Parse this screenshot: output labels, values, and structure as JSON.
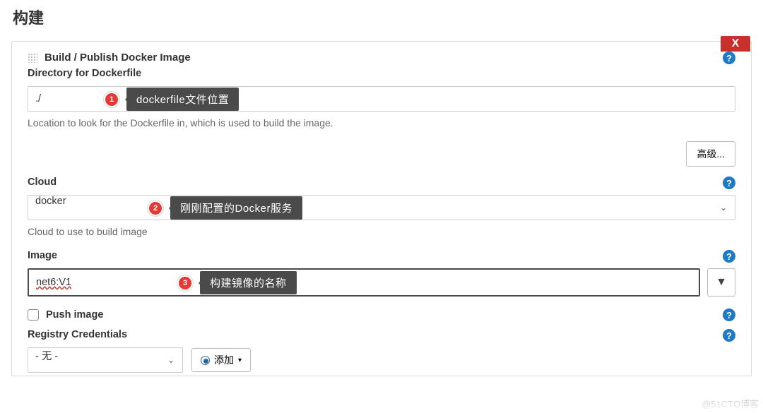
{
  "page": {
    "title": "构建"
  },
  "panel": {
    "header_title": "Build / Publish Docker Image",
    "delete_label": "X"
  },
  "fields": {
    "dockerfile": {
      "label": "Directory for Dockerfile",
      "value": "./",
      "help": "Location to look for the Dockerfile in, which is used to build the image."
    },
    "advanced_btn": "高级...",
    "cloud": {
      "label": "Cloud",
      "value": "docker",
      "help": "Cloud to use to build image"
    },
    "image": {
      "label": "Image",
      "value": "net6:V1"
    },
    "push_image": {
      "label": "Push image",
      "checked": false
    },
    "registry": {
      "label": "Registry Credentials",
      "selected": "- 无 -",
      "add_label": "添加"
    }
  },
  "annotations": {
    "a1": {
      "num": "1",
      "text": "dockerfile文件位置"
    },
    "a2": {
      "num": "2",
      "text": "刚刚配置的Docker服务"
    },
    "a3": {
      "num": "3",
      "text": "构建镜像的名称"
    }
  },
  "icons": {
    "help_glyph": "?"
  },
  "watermark": "@51CTO博客"
}
